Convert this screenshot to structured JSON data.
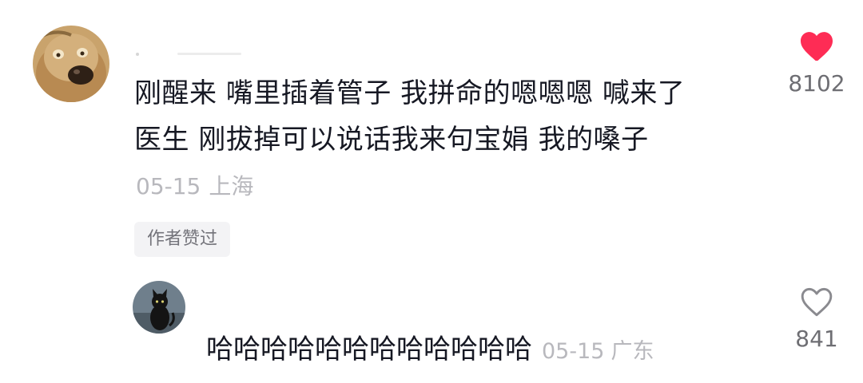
{
  "comment": {
    "avatar_icon": "dog-avatar",
    "text_line1": "刚醒来 嘴里插着管子 我拼命的嗯嗯嗯 喊来了",
    "text_line2": "医生 刚拔掉可以说话我来句宝娟 我的嗓子",
    "date": "05-15",
    "location": "上海",
    "author_badge": "作者赞过",
    "like_count": "8102",
    "liked": true,
    "like_color": "#fe2c55"
  },
  "reply": {
    "avatar_icon": "black-cat-avatar",
    "text": "哈哈哈哈哈哈哈哈哈哈哈哈",
    "date": "05-15",
    "location": "广东",
    "like_count": "841",
    "liked": false
  }
}
